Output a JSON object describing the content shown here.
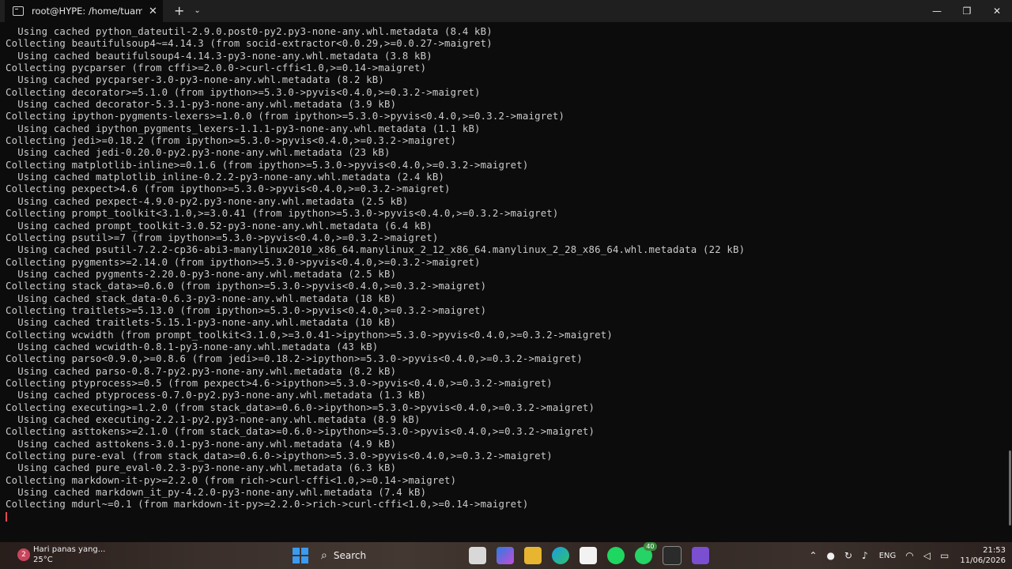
{
  "window": {
    "tab_title": "root@HYPE: /home/tuampek/",
    "tab_close": "✕",
    "new_tab": "+",
    "dropdown": "⌄",
    "minimize": "—",
    "maximize": "❐",
    "close": "✕"
  },
  "terminal": {
    "lines": [
      "  Using cached python_dateutil-2.9.0.post0-py2.py3-none-any.whl.metadata (8.4 kB)",
      "Collecting beautifulsoup4~=4.14.3 (from socid-extractor<0.0.29,>=0.0.27->maigret)",
      "  Using cached beautifulsoup4-4.14.3-py3-none-any.whl.metadata (3.8 kB)",
      "Collecting pycparser (from cffi>=2.0.0->curl-cffi<1.0,>=0.14->maigret)",
      "  Using cached pycparser-3.0-py3-none-any.whl.metadata (8.2 kB)",
      "Collecting decorator>=5.1.0 (from ipython>=5.3.0->pyvis<0.4.0,>=0.3.2->maigret)",
      "  Using cached decorator-5.3.1-py3-none-any.whl.metadata (3.9 kB)",
      "Collecting ipython-pygments-lexers>=1.0.0 (from ipython>=5.3.0->pyvis<0.4.0,>=0.3.2->maigret)",
      "  Using cached ipython_pygments_lexers-1.1.1-py3-none-any.whl.metadata (1.1 kB)",
      "Collecting jedi>=0.18.2 (from ipython>=5.3.0->pyvis<0.4.0,>=0.3.2->maigret)",
      "  Using cached jedi-0.20.0-py2.py3-none-any.whl.metadata (23 kB)",
      "Collecting matplotlib-inline>=0.1.6 (from ipython>=5.3.0->pyvis<0.4.0,>=0.3.2->maigret)",
      "  Using cached matplotlib_inline-0.2.2-py3-none-any.whl.metadata (2.4 kB)",
      "Collecting pexpect>4.6 (from ipython>=5.3.0->pyvis<0.4.0,>=0.3.2->maigret)",
      "  Using cached pexpect-4.9.0-py2.py3-none-any.whl.metadata (2.5 kB)",
      "Collecting prompt_toolkit<3.1.0,>=3.0.41 (from ipython>=5.3.0->pyvis<0.4.0,>=0.3.2->maigret)",
      "  Using cached prompt_toolkit-3.0.52-py3-none-any.whl.metadata (6.4 kB)",
      "Collecting psutil>=7 (from ipython>=5.3.0->pyvis<0.4.0,>=0.3.2->maigret)",
      "  Using cached psutil-7.2.2-cp36-abi3-manylinux2010_x86_64.manylinux_2_12_x86_64.manylinux_2_28_x86_64.whl.metadata (22 kB)",
      "Collecting pygments>=2.14.0 (from ipython>=5.3.0->pyvis<0.4.0,>=0.3.2->maigret)",
      "  Using cached pygments-2.20.0-py3-none-any.whl.metadata (2.5 kB)",
      "Collecting stack_data>=0.6.0 (from ipython>=5.3.0->pyvis<0.4.0,>=0.3.2->maigret)",
      "  Using cached stack_data-0.6.3-py3-none-any.whl.metadata (18 kB)",
      "Collecting traitlets>=5.13.0 (from ipython>=5.3.0->pyvis<0.4.0,>=0.3.2->maigret)",
      "  Using cached traitlets-5.15.1-py3-none-any.whl.metadata (10 kB)",
      "Collecting wcwidth (from prompt_toolkit<3.1.0,>=3.0.41->ipython>=5.3.0->pyvis<0.4.0,>=0.3.2->maigret)",
      "  Using cached wcwidth-0.8.1-py3-none-any.whl.metadata (43 kB)",
      "Collecting parso<0.9.0,>=0.8.6 (from jedi>=0.18.2->ipython>=5.3.0->pyvis<0.4.0,>=0.3.2->maigret)",
      "  Using cached parso-0.8.7-py2.py3-none-any.whl.metadata (8.2 kB)",
      "Collecting ptyprocess>=0.5 (from pexpect>4.6->ipython>=5.3.0->pyvis<0.4.0,>=0.3.2->maigret)",
      "  Using cached ptyprocess-0.7.0-py2.py3-none-any.whl.metadata (1.3 kB)",
      "Collecting executing>=1.2.0 (from stack_data>=0.6.0->ipython>=5.3.0->pyvis<0.4.0,>=0.3.2->maigret)",
      "  Using cached executing-2.2.1-py2.py3-none-any.whl.metadata (8.9 kB)",
      "Collecting asttokens>=2.1.0 (from stack_data>=0.6.0->ipython>=5.3.0->pyvis<0.4.0,>=0.3.2->maigret)",
      "  Using cached asttokens-3.0.1-py3-none-any.whl.metadata (4.9 kB)",
      "Collecting pure-eval (from stack_data>=0.6.0->ipython>=5.3.0->pyvis<0.4.0,>=0.3.2->maigret)",
      "  Using cached pure_eval-0.2.3-py3-none-any.whl.metadata (6.3 kB)",
      "Collecting markdown-it-py>=2.2.0 (from rich->curl-cffi<1.0,>=0.14->maigret)",
      "  Using cached markdown_it_py-4.2.0-py3-none-any.whl.metadata (7.4 kB)",
      "Collecting mdurl~=0.1 (from markdown-it-py>=2.2.0->rich->curl-cffi<1.0,>=0.14->maigret)"
    ]
  },
  "taskbar": {
    "weather_badge": "2",
    "weather_text": "Hari panas yang...",
    "temperature": "25°C",
    "search_label": "Search",
    "whatsapp_badge": "40",
    "language": "ENG",
    "time": "21:53",
    "date": "11/06/2026"
  },
  "colors": {
    "terminal_bg": "#0c0c0c",
    "terminal_text": "#cccccc",
    "cursor": "#e74856",
    "titlebar_bg": "#1f1f1f",
    "start_blue": "#3a9bf0"
  }
}
